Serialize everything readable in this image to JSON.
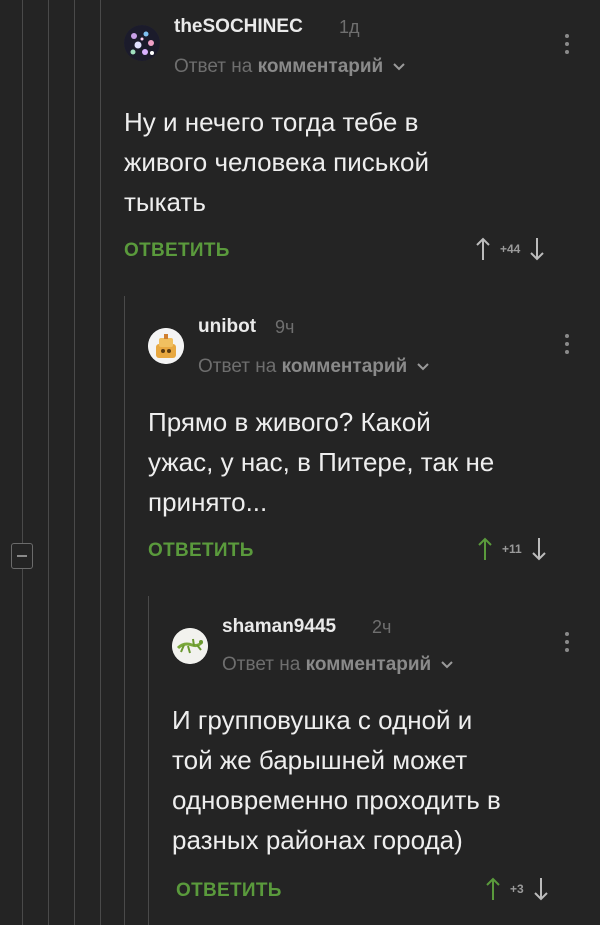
{
  "comments": [
    {
      "username": "theSOCHINEC",
      "time": "1д",
      "reply_prefix": "Ответ на",
      "reply_target": "комментарий",
      "body": [
        "Ну и нечего тогда тебе в",
        "живого человека писькой",
        "тыкать"
      ],
      "reply_label": "ОТВЕТИТЬ",
      "rating": "+44",
      "avatar": "galaxy-avatar"
    },
    {
      "username": "unibot",
      "time": "9ч",
      "reply_prefix": "Ответ на",
      "reply_target": "комментарий",
      "body": [
        "Прямо в живого? Какой",
        "ужас, у нас, в Питере, так не",
        "принято..."
      ],
      "reply_label": "ОТВЕТИТЬ",
      "rating": "+11",
      "avatar": "cartoon-avatar"
    },
    {
      "username": "shaman9445",
      "time": "2ч",
      "reply_prefix": "Ответ на",
      "reply_target": "комментарий",
      "body": [
        "И групповушка с одной и",
        "той же барышней может",
        "одновременно проходить в",
        "разных районах города)"
      ],
      "reply_label": "ОТВЕТИТЬ",
      "rating": "+3",
      "avatar": "lizard-avatar"
    }
  ],
  "colors": {
    "background": "#242424",
    "reply_green": "#5a9a3c",
    "upvote_green": "#5a9a3c",
    "thread_line": "#4a4a4a"
  },
  "icons": {
    "upvote": "arrow-up-icon",
    "downvote": "arrow-down-icon",
    "menu": "kebab-menu-icon",
    "collapse": "collapse-minus-icon",
    "reply_dropdown": "chevron-down-icon"
  }
}
